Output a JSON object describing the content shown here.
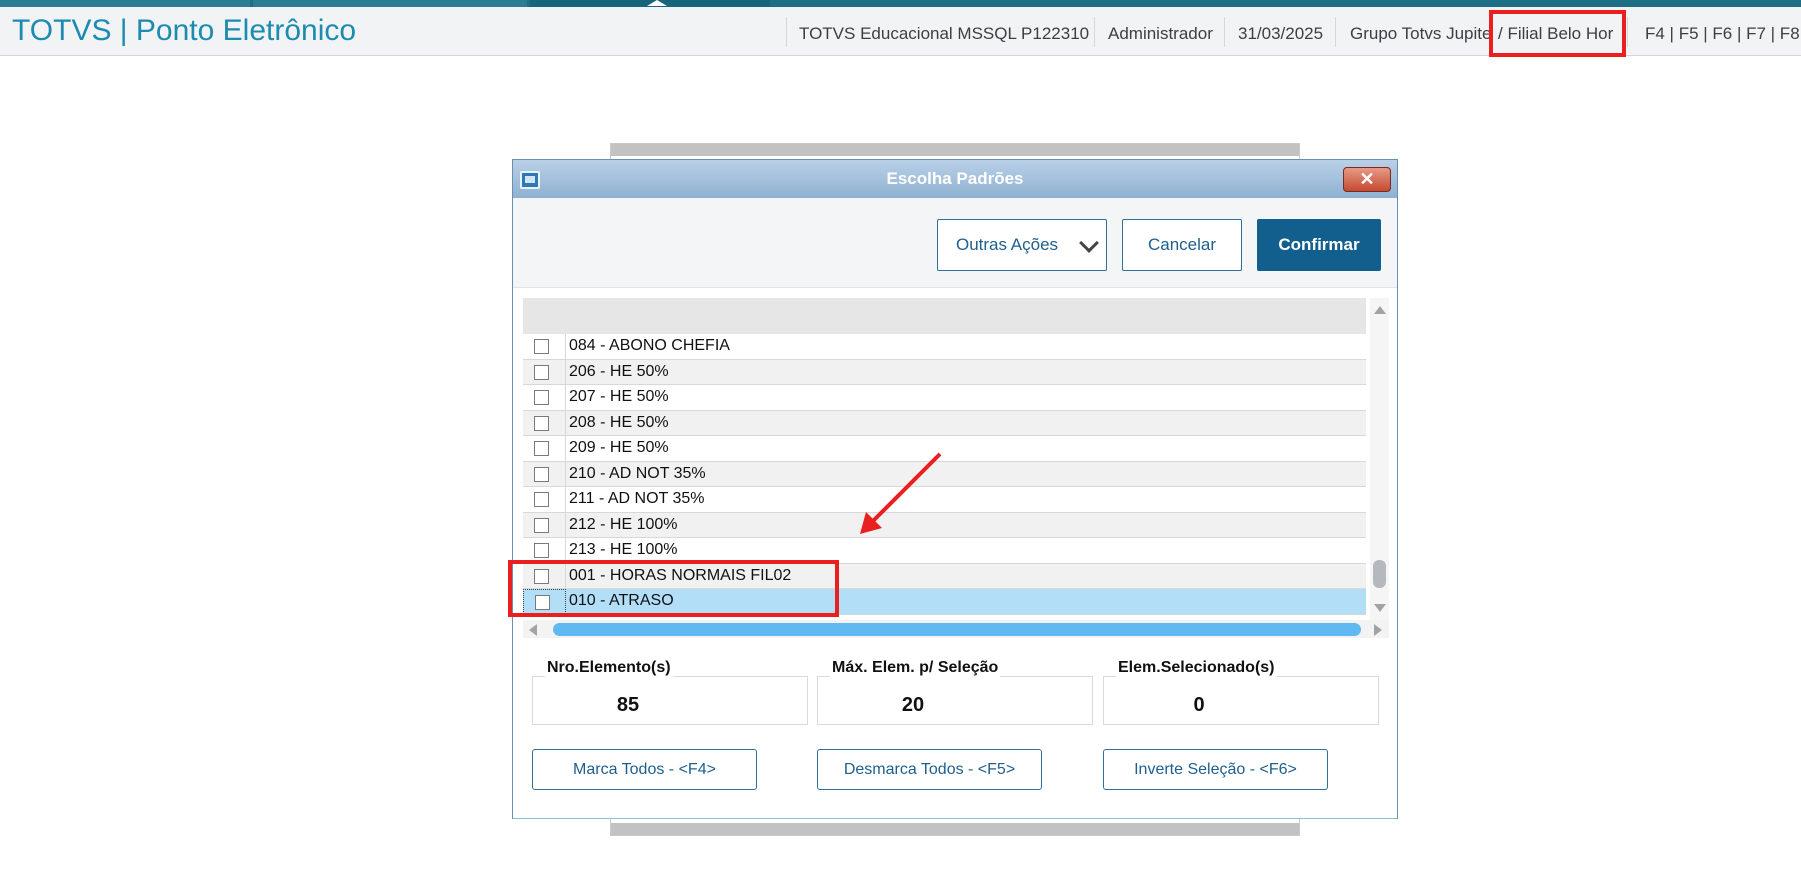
{
  "header": {
    "app_title": "TOTVS | Ponto Eletrônico",
    "environment": "TOTVS Educacional MSSQL P122310",
    "user": "Administrador",
    "date": "31/03/2025",
    "group": "Grupo Totvs Jupite",
    "branch": "/ Filial Belo Hor",
    "shortcuts": "F4 | F5 | F6 | F7 | F8"
  },
  "dialog": {
    "title": "Escolha Padrões",
    "close_icon": "close-icon",
    "toolbar": {
      "other_actions": "Outras Ações",
      "cancel": "Cancelar",
      "confirm": "Confirmar"
    },
    "rows": [
      {
        "label": "084 - ABONO CHEFIA",
        "checked": false
      },
      {
        "label": "206 - HE 50%",
        "checked": false
      },
      {
        "label": "207 - HE 50%",
        "checked": false
      },
      {
        "label": "208 - HE 50%",
        "checked": false
      },
      {
        "label": "209 - HE 50%",
        "checked": false
      },
      {
        "label": "210 - AD NOT 35%",
        "checked": false
      },
      {
        "label": "211 - AD NOT 35%",
        "checked": false
      },
      {
        "label": "212 - HE 100%",
        "checked": false
      },
      {
        "label": "213 - HE 100%",
        "checked": false
      },
      {
        "label": "001 - HORAS NORMAIS FIL02",
        "checked": false
      },
      {
        "label": "010 - ATRASO",
        "checked": false,
        "selected": true
      }
    ],
    "stats": {
      "elements_label": "Nro.Elemento(s)",
      "elements_value": "85",
      "max_label": "Máx. Elem. p/ Seleção",
      "max_value": "20",
      "selected_label": "Elem.Selecionado(s)",
      "selected_value": "0"
    },
    "buttons": {
      "mark_all": "Marca Todos - <F4>",
      "unmark_all": "Desmarca Todos - <F5>",
      "invert": "Inverte Seleção - <F6>"
    }
  },
  "colors": {
    "highlight_red": "#ea1f1f",
    "primary_blue": "#125f8e",
    "selected_row": "#b3def8"
  }
}
